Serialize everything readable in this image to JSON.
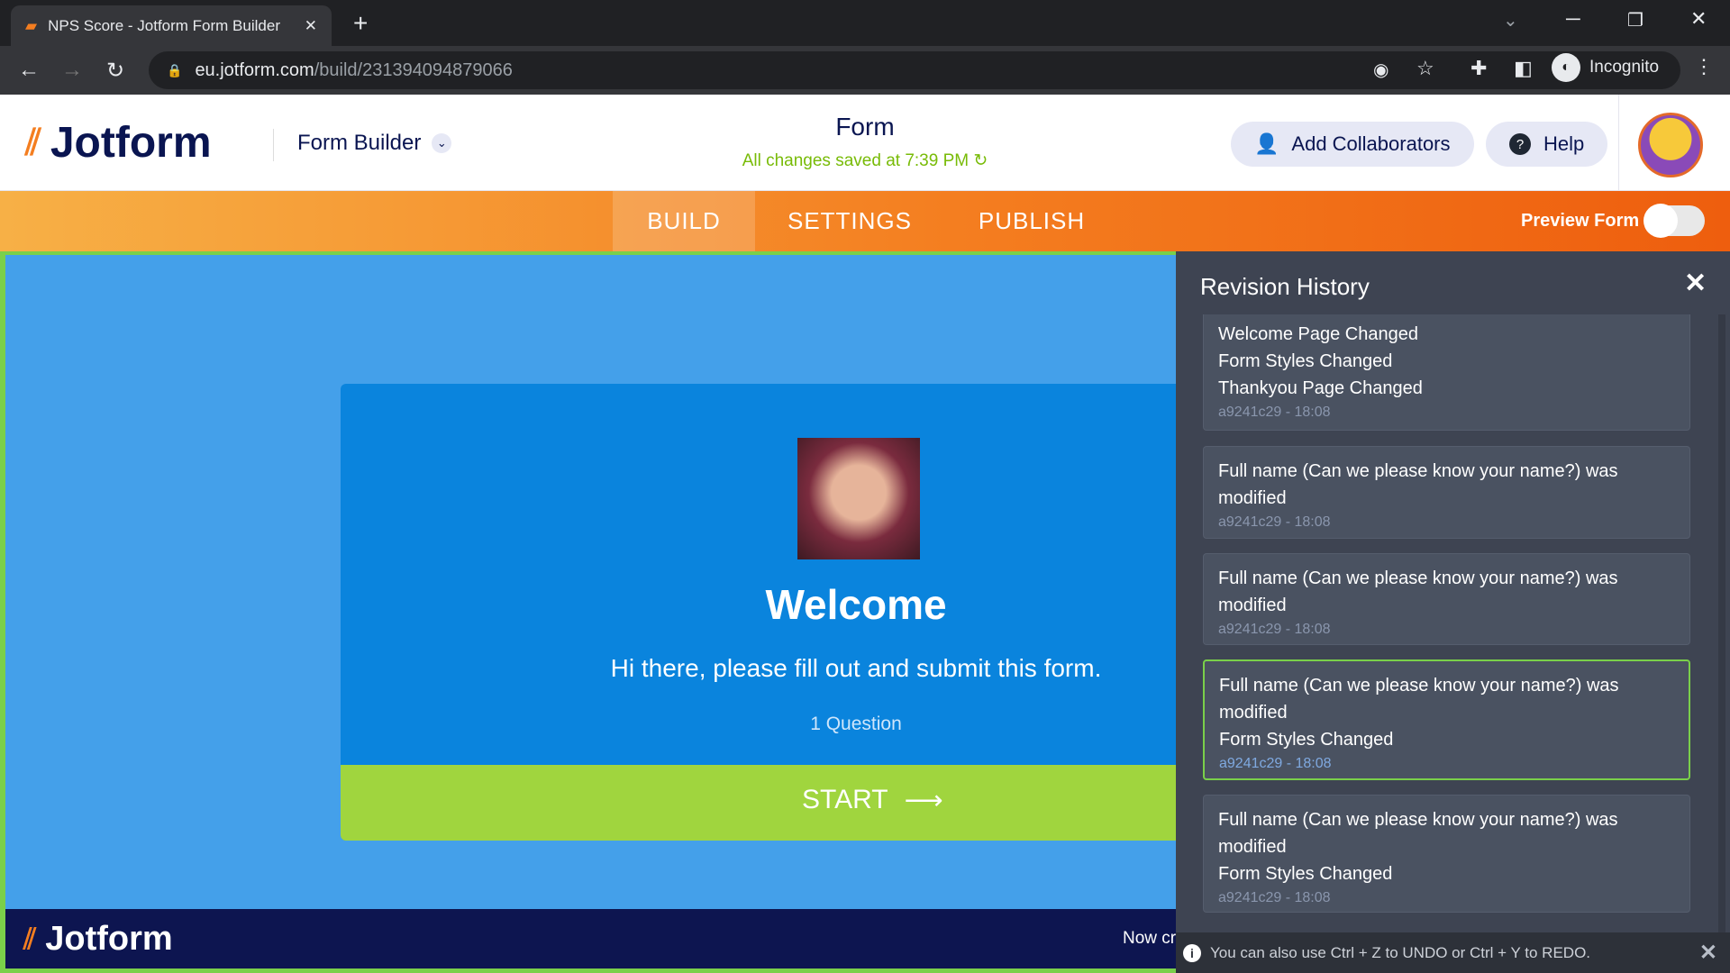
{
  "browser": {
    "tab_title": "NPS Score - Jotform Form Builder",
    "url_domain": "eu.jotform.com",
    "url_path": "/build/231394094879066",
    "profile": "Incognito"
  },
  "header": {
    "logo": "Jotform",
    "product": "Form Builder",
    "title": "Form",
    "saved_status": "All changes saved at 7:39 PM",
    "add_collaborators": "Add Collaborators",
    "help": "Help"
  },
  "nav": {
    "tabs": [
      {
        "label": "BUILD",
        "active": true
      },
      {
        "label": "SETTINGS"
      },
      {
        "label": "PUBLISH"
      }
    ],
    "preview_label": "Preview Form",
    "preview_on": false
  },
  "form": {
    "heading": "Welcome",
    "subtitle": "Hi there, please fill out and submit this form.",
    "question_count": "1 Question",
    "start_label": "START",
    "accent": "#0a84dd",
    "start_color": "#a0d53e"
  },
  "bottom_bar": {
    "logo": "Jotform",
    "text": "Now cr"
  },
  "revision_history": {
    "title": "Revision History",
    "items": [
      {
        "lines": [
          "Welcome Page Changed",
          "Form Styles Changed",
          "Thankyou Page Changed"
        ],
        "meta": "a9241c29 - 18:08"
      },
      {
        "lines": [
          "Full name (Can we please know your name?) was modified"
        ],
        "meta": "a9241c29 - 18:08"
      },
      {
        "lines": [
          "Full name (Can we please know your name?) was modified"
        ],
        "meta": "a9241c29 - 18:08"
      },
      {
        "lines": [
          "Full name (Can we please know your name?) was modified",
          "Form Styles Changed"
        ],
        "meta": "a9241c29 - 18:08",
        "selected": true
      },
      {
        "lines": [
          "Full name (Can we please know your name?) was modified",
          "Form Styles Changed"
        ],
        "meta": "a9241c29 - 18:08"
      }
    ],
    "tip": "You can also use Ctrl + Z to UNDO or Ctrl + Y to REDO."
  }
}
